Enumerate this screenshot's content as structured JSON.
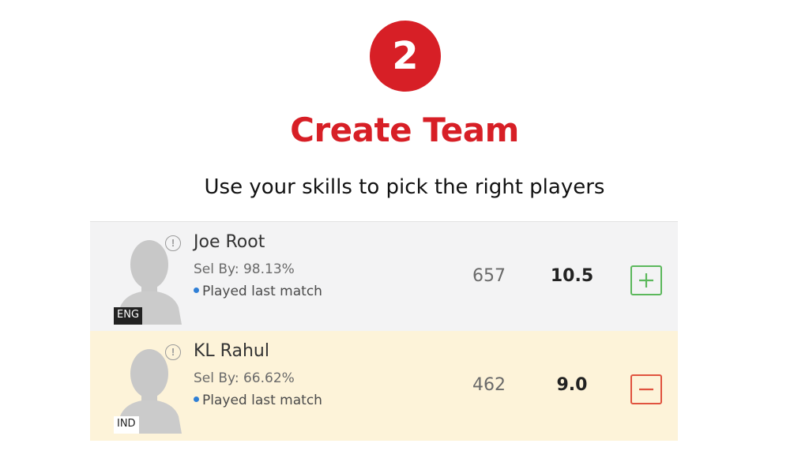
{
  "step": {
    "number": "2",
    "title": "Create Team",
    "subtitle": "Use your skills to pick the right players"
  },
  "colors": {
    "accent": "#d71f26",
    "add": "#5cb85c",
    "remove": "#e0533f",
    "played_dot": "#2f7fd6",
    "selected_row": "#fdf3d9",
    "default_row": "#f3f3f4"
  },
  "players": [
    {
      "name": "Joe Root",
      "sel_by": "Sel By: 98.13%",
      "status": "Played last match",
      "points": "657",
      "credits": "10.5",
      "country": "ENG",
      "action_icon": "plus-icon"
    },
    {
      "name": "KL Rahul",
      "sel_by": "Sel By: 66.62%",
      "status": "Played last match",
      "points": "462",
      "credits": "9.0",
      "country": "IND",
      "action_icon": "minus-icon"
    }
  ]
}
